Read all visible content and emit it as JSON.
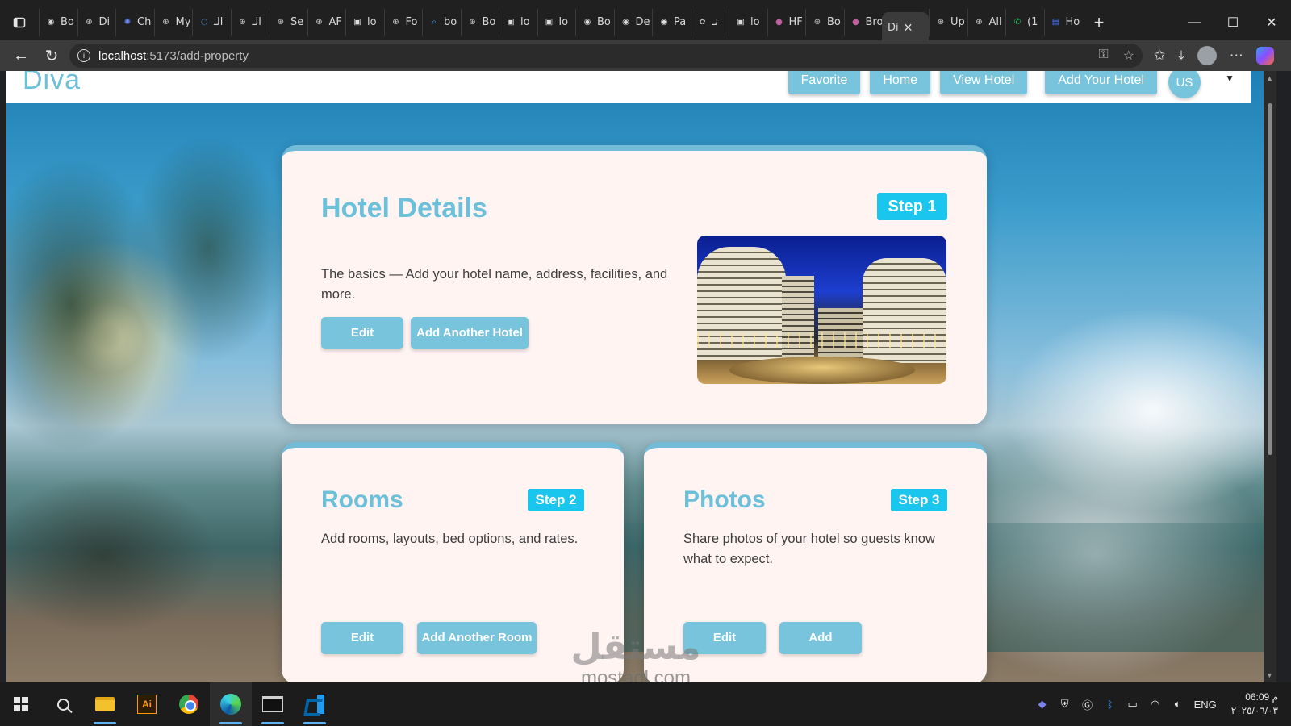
{
  "browser": {
    "tabs": [
      {
        "label": "Bo",
        "icon": "github-icon"
      },
      {
        "label": "Di",
        "icon": "globe-icon"
      },
      {
        "label": "Ch",
        "icon": "chatgpt-icon"
      },
      {
        "label": "My",
        "icon": "globe-icon"
      },
      {
        "label": "الـ",
        "icon": "loading-icon"
      },
      {
        "label": "الـ",
        "icon": "globe-icon"
      },
      {
        "label": "Se",
        "icon": "globe-icon"
      },
      {
        "label": "AF",
        "icon": "globe-icon"
      },
      {
        "label": "lo",
        "icon": "page-icon"
      },
      {
        "label": "Fo",
        "icon": "globe-icon"
      },
      {
        "label": "bo",
        "icon": "search-icon"
      },
      {
        "label": "Bo",
        "icon": "globe-icon"
      },
      {
        "label": "lo",
        "icon": "page-icon"
      },
      {
        "label": "lo",
        "icon": "page-icon"
      },
      {
        "label": "Bo",
        "icon": "github-icon"
      },
      {
        "label": "De",
        "icon": "github-icon"
      },
      {
        "label": "Pa",
        "icon": "github-icon"
      },
      {
        "label": "نـ",
        "icon": "openai-icon"
      },
      {
        "label": "lo",
        "icon": "page-icon"
      },
      {
        "label": "HF",
        "icon": "orb-icon"
      },
      {
        "label": "Bo",
        "icon": "globe-icon"
      },
      {
        "label": "Bro",
        "icon": "orb-icon"
      }
    ],
    "active_tab": {
      "label": "Di"
    },
    "tabs_after": [
      {
        "label": "Up",
        "icon": "globe-icon"
      },
      {
        "label": "All",
        "icon": "globe-icon"
      },
      {
        "label": "(1",
        "icon": "whatsapp-icon"
      },
      {
        "label": "Ho",
        "icon": "forms-icon"
      }
    ],
    "url_host": "localhost",
    "url_path": ":5173/add-property"
  },
  "site": {
    "logo": "Diva",
    "nav": {
      "favorite": "Favorite",
      "home": "Home",
      "view_hotel": "View Hotel",
      "add_hotel": "Add Your Hotel",
      "avatar": "US"
    }
  },
  "steps": {
    "hotel": {
      "title": "Hotel Details",
      "step": "Step 1",
      "description": "The basics — Add your hotel name, address, facilities, and more.",
      "edit": "Edit",
      "add": "Add Another Hotel"
    },
    "rooms": {
      "title": "Rooms",
      "step": "Step 2",
      "description": "Add rooms, layouts, bed options, and rates.",
      "edit": "Edit",
      "add": "Add Another Room"
    },
    "photos": {
      "title": "Photos",
      "step": "Step 3",
      "description": "Share photos of your hotel so guests know what to expect.",
      "edit": "Edit",
      "add": "Add"
    }
  },
  "watermark": {
    "arabic": "مستقل",
    "latin": "mostaql.com"
  },
  "taskbar": {
    "language": "ENG",
    "time": "06:09 م",
    "date": "٢٠٢٥/٠٦/٠٣"
  }
}
